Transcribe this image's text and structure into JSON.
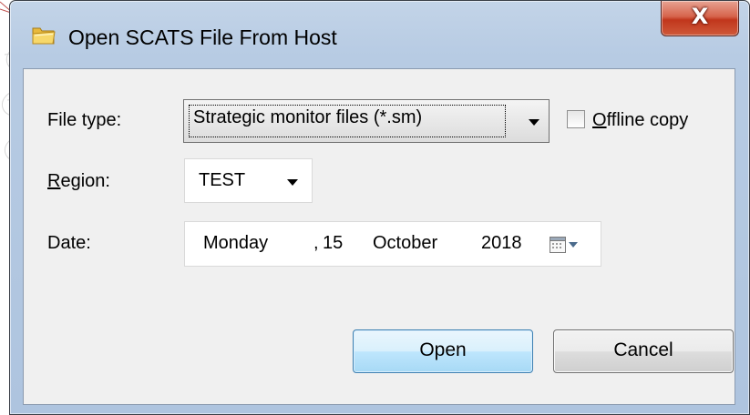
{
  "window": {
    "title": "Open SCATS File From Host",
    "close_label": "X"
  },
  "form": {
    "file_type": {
      "label_pre": "File type:",
      "value": "Strategic monitor files (*.sm)"
    },
    "offline": {
      "label_accel": "O",
      "label_rest": "ffline copy",
      "checked": false
    },
    "region": {
      "label_accel": "R",
      "label_rest": "egion:",
      "value": "TEST"
    },
    "date": {
      "label": "Date:",
      "weekday": "Monday",
      "sep": ",",
      "day": "15",
      "month": "October",
      "year": "2018"
    }
  },
  "buttons": {
    "open_label": "Open",
    "cancel_label": "Cancel"
  },
  "colors": {
    "title_bar": "#b9cde4",
    "close_button": "#c94a30",
    "default_button": "#bee6fd",
    "client_bg": "#f0f0f0"
  },
  "icons": {
    "title": "folder-icon",
    "date_picker": "calendar-icon"
  }
}
